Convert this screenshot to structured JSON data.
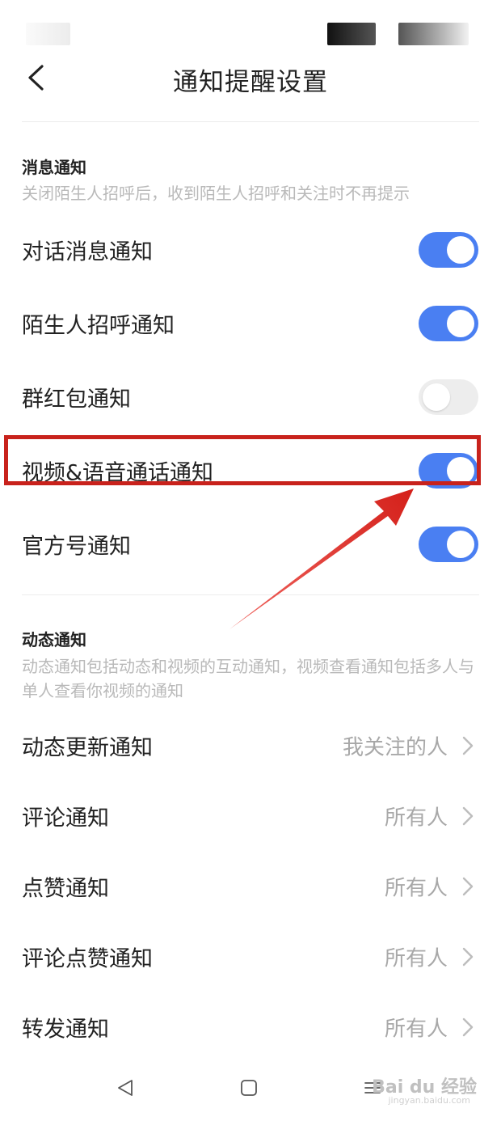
{
  "header": {
    "title": "通知提醒设置"
  },
  "message_section": {
    "title": "消息通知",
    "description": "关闭陌生人招呼后，收到陌生人招呼和关注时不再提示",
    "items": [
      {
        "label": "对话消息通知",
        "enabled": true
      },
      {
        "label": "陌生人招呼通知",
        "enabled": true
      },
      {
        "label": "群红包通知",
        "enabled": false
      },
      {
        "label": "视频&语音通话通知",
        "enabled": true
      },
      {
        "label": "官方号通知",
        "enabled": true
      }
    ]
  },
  "dynamic_section": {
    "title": "动态通知",
    "description": "动态通知包括动态和视频的互动通知，视频查看通知包括多人与单人查看你视频的通知",
    "items": [
      {
        "label": "动态更新通知",
        "value": "我关注的人"
      },
      {
        "label": "评论通知",
        "value": "所有人"
      },
      {
        "label": "点赞通知",
        "value": "所有人"
      },
      {
        "label": "评论点赞通知",
        "value": "所有人"
      },
      {
        "label": "转发通知",
        "value": "所有人"
      }
    ]
  },
  "annotation": {
    "highlight_color": "#c8221c",
    "highlighted_item_index": 3
  },
  "toggle_colors": {
    "on": "#4a7ff2",
    "off": "#ededed"
  },
  "navbar": {
    "icons": [
      "back-triangle-icon",
      "home-square-icon",
      "menu-lines-icon"
    ]
  },
  "watermark": {
    "text": "Bai du 经验",
    "sub": "jingyan.baidu.com"
  }
}
